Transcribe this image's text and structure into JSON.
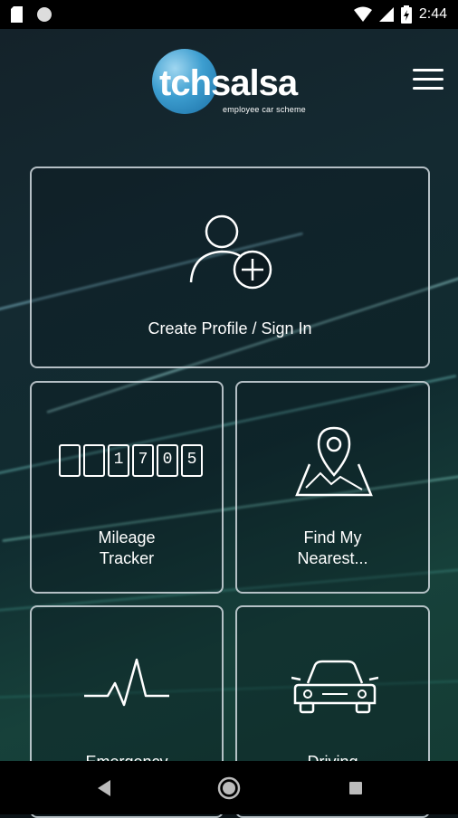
{
  "status_bar": {
    "time": "2:44",
    "left_icons": [
      "sd-card-icon",
      "circle-notification-icon"
    ],
    "right_icons": [
      "wifi-icon",
      "signal-icon",
      "battery-icon"
    ]
  },
  "header": {
    "logo_text": "tchsalsa",
    "logo_tagline": "employee car scheme",
    "menu_icon": "hamburger-menu-icon"
  },
  "tiles": {
    "profile": {
      "label": "Create Profile / Sign In",
      "icon": "add-user-icon"
    },
    "mileage": {
      "line1": "Mileage",
      "line2": "Tracker",
      "icon": "odometer-icon",
      "digits": [
        "",
        "",
        "1",
        "7",
        "0",
        "5"
      ]
    },
    "nearest": {
      "line1": "Find My",
      "line2": "Nearest...",
      "icon": "map-pin-icon"
    },
    "emergency": {
      "label": "Emergency",
      "icon": "heartbeat-icon"
    },
    "driving": {
      "label": "Driving",
      "icon": "car-icon"
    }
  },
  "nav": {
    "back_icon": "back-triangle-icon",
    "home_icon": "home-circle-icon",
    "recents_icon": "recents-square-icon"
  }
}
